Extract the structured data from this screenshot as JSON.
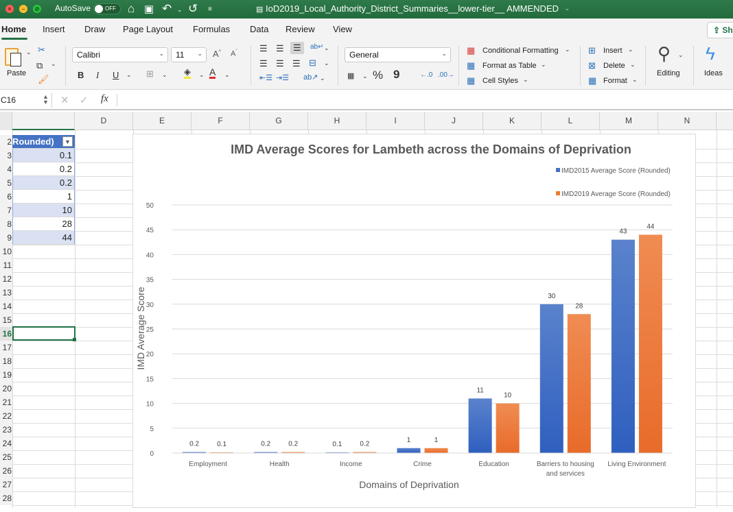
{
  "titlebar": {
    "autosave_label": "AutoSave",
    "autosave_state": "OFF",
    "document_title": "IoD2019_Local_Authority_District_Summaries__lower-tier__ AMMENDED",
    "icons": [
      "home-icon",
      "save-icon",
      "undo-icon",
      "redo-icon",
      "customize-icon"
    ]
  },
  "ribbon_tabs": [
    {
      "label": "Home",
      "active": true
    },
    {
      "label": "Insert"
    },
    {
      "label": "Draw"
    },
    {
      "label": "Page Layout"
    },
    {
      "label": "Formulas"
    },
    {
      "label": "Data"
    },
    {
      "label": "Review"
    },
    {
      "label": "View"
    }
  ],
  "share_label": "Sh",
  "ribbon": {
    "paste_label": "Paste",
    "font_name": "Calibri",
    "font_size": "11",
    "bold": "B",
    "italic": "I",
    "underline": "U",
    "number_format": "General",
    "percent": "%",
    "comma": "9",
    "conditional_formatting": "Conditional Formatting",
    "format_as_table": "Format as Table",
    "cell_styles": "Cell Styles",
    "insert": "Insert",
    "delete": "Delete",
    "format": "Format",
    "editing": "Editing",
    "ideas": "Ideas",
    "colors": {
      "highlight": "#f5e52a",
      "font_color": "#e02a2a",
      "accent": "#217346"
    }
  },
  "formula_bar": {
    "name_box": "C16",
    "fx": "fx",
    "value": ""
  },
  "columns": [
    "D",
    "E",
    "F",
    "G",
    "H",
    "I",
    "J",
    "K",
    "L",
    "M",
    "N"
  ],
  "rows": [
    "2",
    "3",
    "4",
    "5",
    "6",
    "7",
    "8",
    "9",
    "10",
    "11",
    "12",
    "13",
    "14",
    "15",
    "16",
    "17",
    "18",
    "19",
    "20",
    "21",
    "22",
    "23",
    "24",
    "25",
    "26",
    "27",
    "28"
  ],
  "active_row": "16",
  "table": {
    "header": "Rounded)",
    "values": [
      "0.1",
      "0.2",
      "0.2",
      "1",
      "10",
      "28",
      "44"
    ]
  },
  "chart_data": {
    "type": "bar",
    "title": "IMD Average Scores for Lambeth across the Domains of Deprivation",
    "xlabel": "Domains of Deprivation",
    "ylabel": "IMD Average Score",
    "ylim": [
      0,
      50
    ],
    "yticks": [
      0,
      5,
      10,
      15,
      20,
      25,
      30,
      35,
      40,
      45,
      50
    ],
    "grid": true,
    "legend_position": "top-right",
    "categories": [
      "Employment",
      "Health",
      "Income",
      "Crime",
      "Education",
      "Barriers to housing and services",
      "Living Environment"
    ],
    "category_lines": [
      [
        "Employment"
      ],
      [
        "Health"
      ],
      [
        "Income"
      ],
      [
        "Crime"
      ],
      [
        "Education"
      ],
      [
        "Barriers to housing",
        "and services"
      ],
      [
        "Living Environment"
      ]
    ],
    "series": [
      {
        "name": "IMD2015 Average Score (Rounded)",
        "color": "#4472c4",
        "values": [
          0.2,
          0.2,
          0.1,
          1,
          11,
          30,
          43
        ],
        "labels": [
          "0.2",
          "0.2",
          "0.1",
          "1",
          "11",
          "30",
          "43"
        ]
      },
      {
        "name": "IMD2019 Average Score (Rounded)",
        "color": "#ed7d31",
        "values": [
          0.1,
          0.2,
          0.2,
          1,
          10,
          28,
          44
        ],
        "labels": [
          "0.1",
          "0.2",
          "0.2",
          "1",
          "10",
          "28",
          "44"
        ]
      }
    ]
  }
}
